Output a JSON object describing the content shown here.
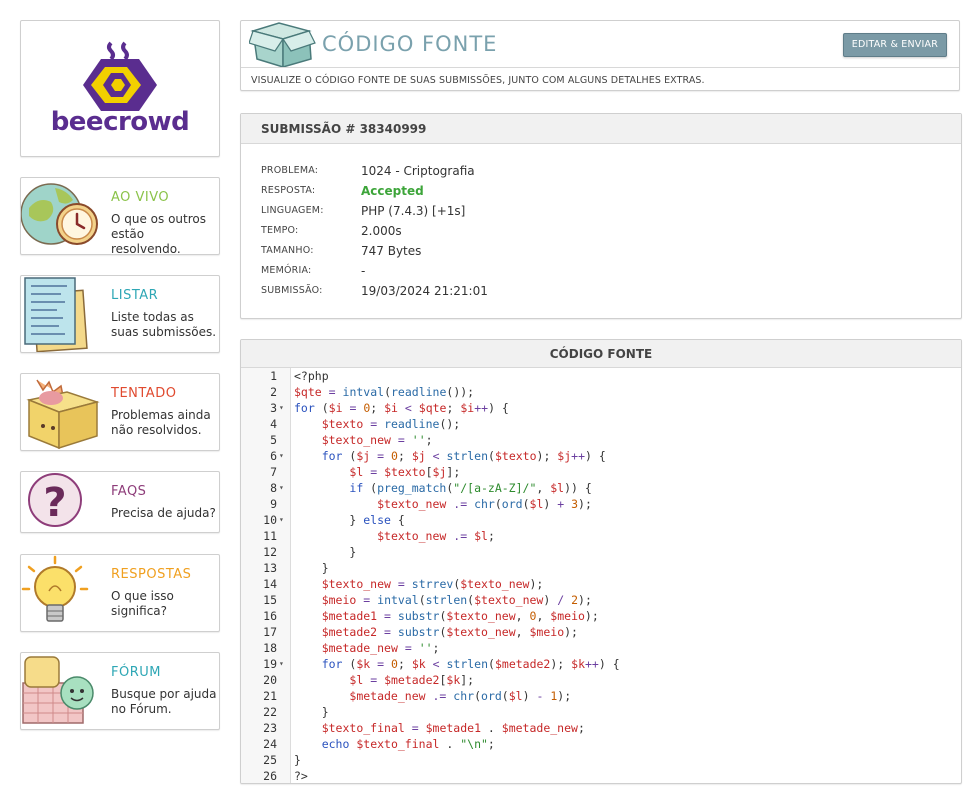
{
  "brand": {
    "name": "beecrowd"
  },
  "colors": {
    "brand": "#5a2d8f",
    "accent_yellow": "#f2d000",
    "header_title": "#7aa1ad",
    "accepted": "#3da53a"
  },
  "sidebar": {
    "items": [
      {
        "title": "AO VIVO",
        "desc": "O que os outros estão resolvendo.",
        "color": "#8bc34a",
        "icon": "globe-clock-icon"
      },
      {
        "title": "LISTAR",
        "desc": "Liste todas as suas submissões.",
        "color": "#2ea7b5",
        "icon": "notes-list-icon"
      },
      {
        "title": "TENTADO",
        "desc": "Problemas ainda não resolvidos.",
        "color": "#e04a2f",
        "icon": "box-icon"
      },
      {
        "title": "FAQS",
        "desc": "Precisa de ajuda?",
        "color": "#8e3d7a",
        "icon": "question-mark-icon"
      },
      {
        "title": "RESPOSTAS",
        "desc": "O que isso significa?",
        "color": "#f0a020",
        "icon": "lightbulb-icon"
      },
      {
        "title": "FÓRUM",
        "desc": "Busque por ajuda no Fórum.",
        "color": "#2ea7b5",
        "icon": "forum-chat-icon"
      }
    ]
  },
  "header": {
    "title": "CÓDIGO FONTE",
    "edit_button": "EDITAR & ENVIAR",
    "subtitle": "VISUALIZE O CÓDIGO FONTE DE SUAS SUBMISSÕES, JUNTO COM ALGUNS DETALHES EXTRAS."
  },
  "submission": {
    "heading": "SUBMISSÃO # 38340999",
    "details": [
      {
        "label": "PROBLEMA:",
        "value": "1024 - Criptografia"
      },
      {
        "label": "RESPOSTA:",
        "value": "Accepted"
      },
      {
        "label": "LINGUAGEM:",
        "value": "PHP (7.4.3) [+1s]"
      },
      {
        "label": "TEMPO:",
        "value": "2.000s"
      },
      {
        "label": "TAMANHO:",
        "value": "747 Bytes"
      },
      {
        "label": "MEMÓRIA:",
        "value": "-"
      },
      {
        "label": "SUBMISSÃO:",
        "value": "19/03/2024 21:21:01"
      }
    ]
  },
  "code": {
    "heading": "CÓDIGO FONTE",
    "fold_lines": [
      3,
      6,
      8,
      10,
      19
    ],
    "lines": [
      "<?php",
      "$qte = intval(readline());",
      "for ($i = 0; $i < $qte; $i++) {",
      "    $texto = readline();",
      "    $texto_new = '';",
      "    for ($j = 0; $j < strlen($texto); $j++) {",
      "        $l = $texto[$j];",
      "        if (preg_match(\"/[a-zA-Z]/\", $l)) {",
      "            $texto_new .= chr(ord($l) + 3);",
      "        } else {",
      "            $texto_new .= $l;",
      "        }",
      "    }",
      "    $texto_new = strrev($texto_new);",
      "    $meio = intval(strlen($texto_new) / 2);",
      "    $metade1 = substr($texto_new, 0, $meio);",
      "    $metade2 = substr($texto_new, $meio);",
      "    $metade_new = '';",
      "    for ($k = 0; $k < strlen($metade2); $k++) {",
      "        $l = $metade2[$k];",
      "        $metade_new .= chr(ord($l) - 1);",
      "    }",
      "    $texto_final = $metade1 . $metade_new;",
      "    echo $texto_final . \"\\n\";",
      "}",
      "?>"
    ]
  }
}
